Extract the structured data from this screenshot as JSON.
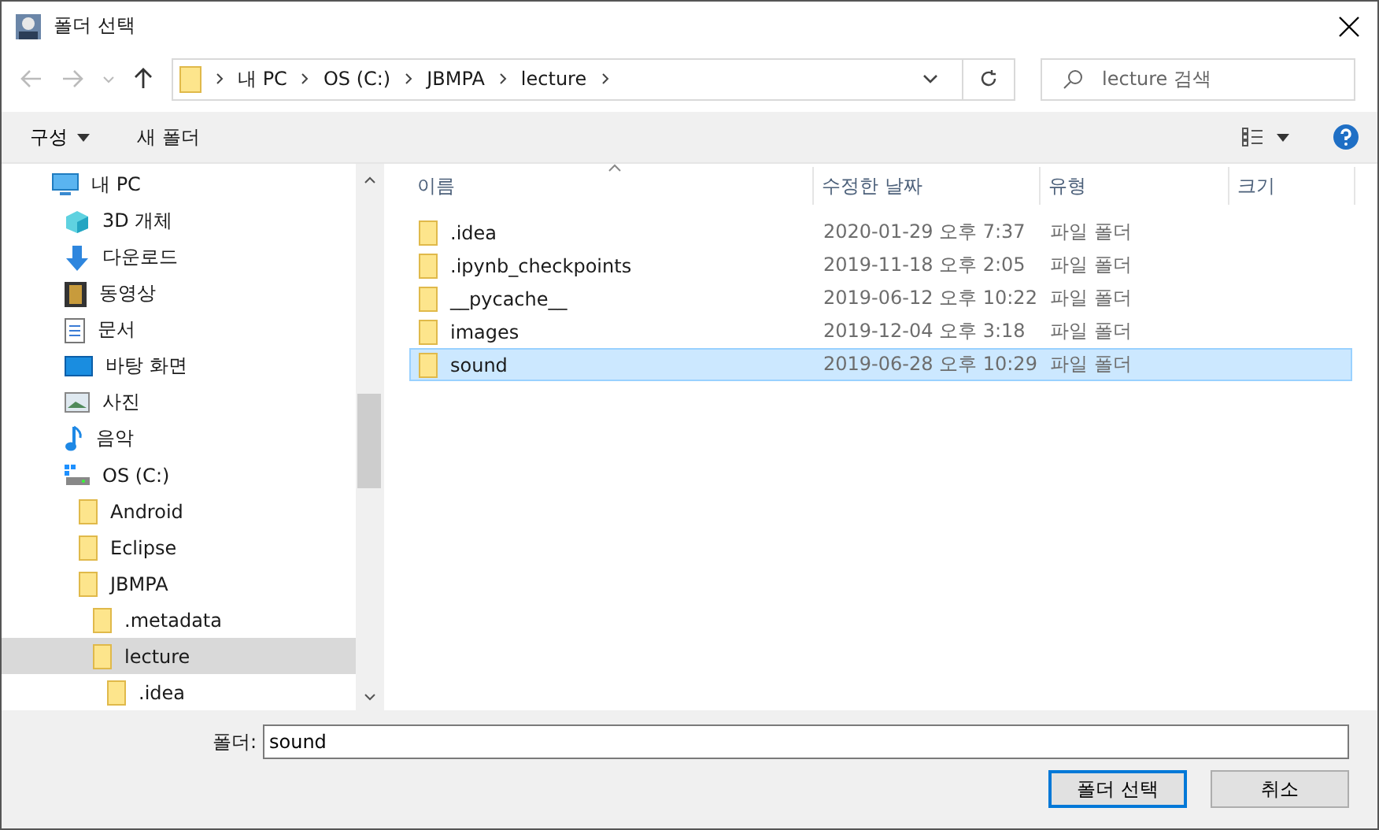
{
  "window": {
    "title": "폴더 선택"
  },
  "address": {
    "crumbs": [
      "내 PC",
      "OS (C:)",
      "JBMPA",
      "lecture"
    ]
  },
  "search": {
    "placeholder": "lecture 검색"
  },
  "toolbar": {
    "organize": "구성",
    "new_folder": "새 폴더"
  },
  "tree": [
    {
      "label": "내 PC",
      "kind": "pc",
      "selected": false,
      "children": [
        {
          "label": "3D 개체",
          "kind": "objects3d",
          "selected": false
        },
        {
          "label": "다운로드",
          "kind": "download",
          "selected": false
        },
        {
          "label": "동영상",
          "kind": "video",
          "selected": false
        },
        {
          "label": "문서",
          "kind": "document",
          "selected": false
        },
        {
          "label": "바탕 화면",
          "kind": "desktop",
          "selected": false
        },
        {
          "label": "사진",
          "kind": "photo",
          "selected": false
        },
        {
          "label": "음악",
          "kind": "music",
          "selected": false
        },
        {
          "label": "OS (C:)",
          "kind": "drive",
          "selected": false,
          "children": [
            {
              "label": "Android",
              "kind": "folder",
              "selected": false
            },
            {
              "label": "Eclipse",
              "kind": "folder",
              "selected": false
            },
            {
              "label": "JBMPA",
              "kind": "folder",
              "selected": false,
              "children": [
                {
                  "label": ".metadata",
                  "kind": "folder",
                  "selected": false
                },
                {
                  "label": "lecture",
                  "kind": "folder",
                  "selected": true,
                  "children": [
                    {
                      "label": ".idea",
                      "kind": "folder",
                      "selected": false
                    }
                  ]
                }
              ]
            }
          ]
        }
      ]
    }
  ],
  "table": {
    "columns": [
      "이름",
      "수정한 날짜",
      "유형",
      "크기"
    ],
    "rows": [
      {
        "name": ".idea",
        "date": "2020-01-29 오후 7:37",
        "type": "파일 폴더",
        "selected": false
      },
      {
        "name": ".ipynb_checkpoints",
        "date": "2019-11-18 오후 2:05",
        "type": "파일 폴더",
        "selected": false
      },
      {
        "name": "__pycache__",
        "date": "2019-06-12 오후 10:22",
        "type": "파일 폴더",
        "selected": false
      },
      {
        "name": "images",
        "date": "2019-12-04 오후 3:18",
        "type": "파일 폴더",
        "selected": false
      },
      {
        "name": "sound",
        "date": "2019-06-28 오후 10:29",
        "type": "파일 폴더",
        "selected": true
      }
    ]
  },
  "folder_field": {
    "label": "폴더:",
    "value": "sound"
  },
  "buttons": [
    {
      "label": "폴더 선택",
      "kind": "primary"
    },
    {
      "label": "취소",
      "kind": "secondary"
    }
  ]
}
